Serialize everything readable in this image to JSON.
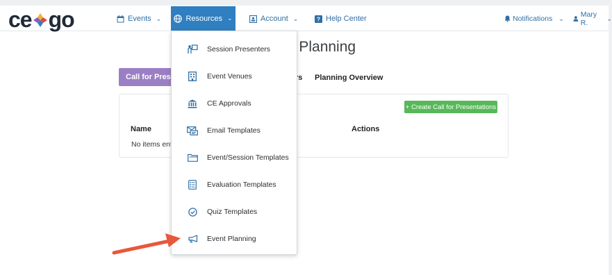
{
  "brand": {
    "logo_left": "ce",
    "logo_right": "go"
  },
  "nav": {
    "events": "Events",
    "resources": "Resources",
    "account": "Account",
    "help": "Help Center",
    "notifications": "Notifications",
    "user": "Mary R."
  },
  "page": {
    "title": "nt Planning",
    "tab_call": "Call for Present",
    "tab_fragment": "rs",
    "tab_overview": "Planning Overview",
    "create_button": "+ Create Call for Presentations",
    "col_name": "Name",
    "col_actions": "Actions",
    "empty": "No items ente"
  },
  "dropdown": {
    "items": [
      {
        "label": "Session Presenters",
        "icon": "presenter-icon"
      },
      {
        "label": "Event Venues",
        "icon": "building-icon"
      },
      {
        "label": "CE Approvals",
        "icon": "institution-icon"
      },
      {
        "label": "Email Templates",
        "icon": "email-template-icon"
      },
      {
        "label": "Event/Session Templates",
        "icon": "folder-icon"
      },
      {
        "label": "Evaluation Templates",
        "icon": "evaluation-icon"
      },
      {
        "label": "Quiz Templates",
        "icon": "check-circle-icon"
      },
      {
        "label": "Event Planning",
        "icon": "megaphone-icon"
      }
    ]
  },
  "colors": {
    "accent": "#2f7fc1",
    "purple": "#9b7fc4",
    "green": "#58b859",
    "arrow": "#e8583a"
  }
}
